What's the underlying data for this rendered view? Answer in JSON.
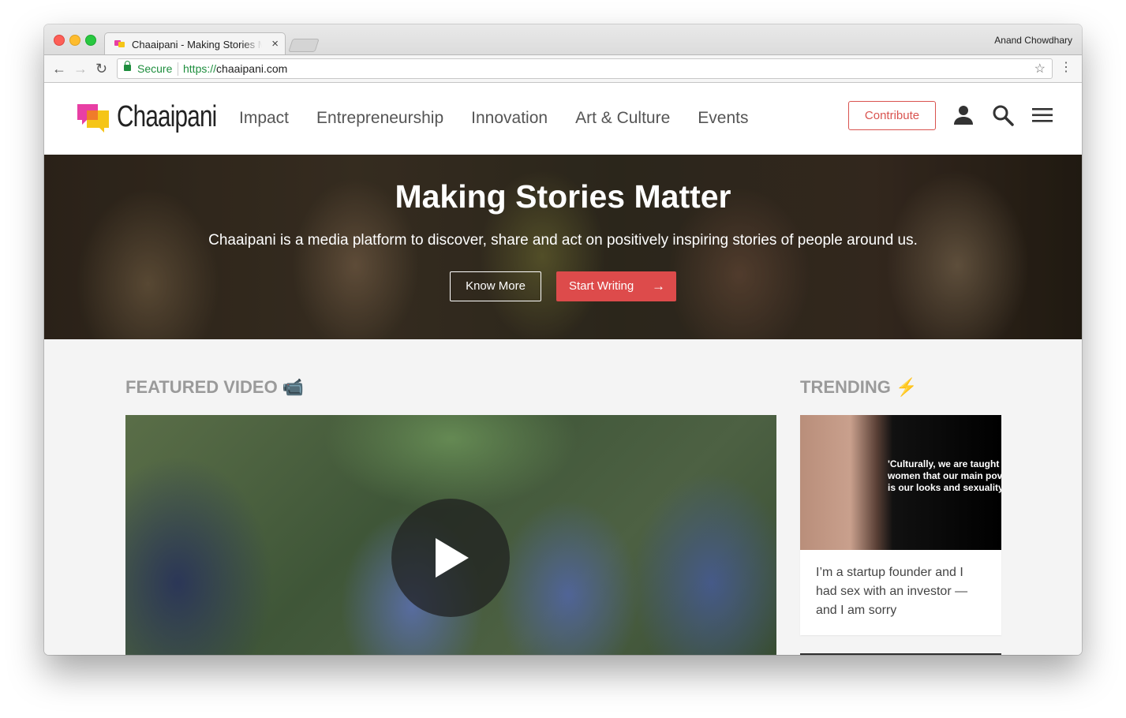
{
  "browser": {
    "tab_title": "Chaaipani - Making Stories Matter",
    "tab_close": "×",
    "profile_name": "Anand Chowdhary",
    "secure_label": "Secure",
    "url_scheme": "https://",
    "url_host": "chaaipani.com"
  },
  "site": {
    "logo_text": "Chaaipani",
    "nav": [
      "Impact",
      "Entrepreneurship",
      "Innovation",
      "Art & Culture",
      "Events"
    ],
    "contribute_label": "Contribute",
    "accent_color": "#d9534f"
  },
  "hero": {
    "title": "Making Stories Matter",
    "subtitle": "Chaaipani is a media platform to discover, share and act on positively inspiring stories of people around us.",
    "know_more_label": "Know More",
    "start_writing_label": "Start Writing"
  },
  "featured": {
    "heading": "FEATURED VIDEO",
    "heading_icon": "📹"
  },
  "trending": {
    "heading": "TRENDING",
    "heading_icon": "⚡",
    "card": {
      "image_quote": "'Culturally, we are taught\nwomen that our main pov\nis our looks and sexuality",
      "headline": "I’m a startup founder and I had sex with an investor — and I am sorry"
    }
  }
}
